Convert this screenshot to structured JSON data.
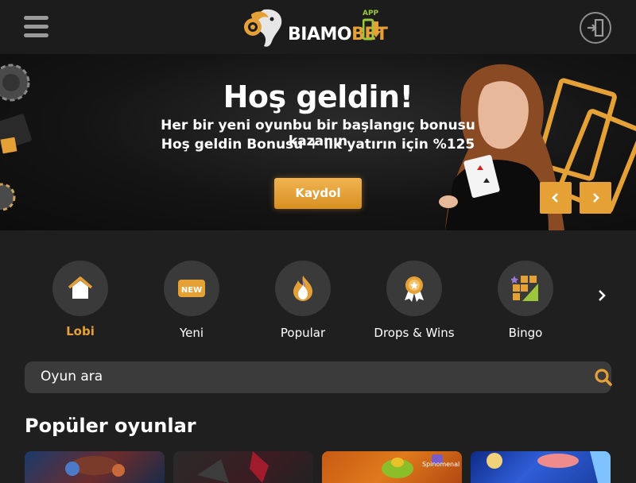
{
  "header": {
    "logo_text_a": "BIAMO",
    "logo_text_b": "BET",
    "app_badge": "APP",
    "menu_icon": "hamburger-menu-icon",
    "login_icon": "login-icon"
  },
  "hero": {
    "title": "Hoş geldin!",
    "line1": "Her bir yeni oyunbu bir başlangıç bonusu kazanın",
    "line2": "Hoş geldin Bonusu + ilk yatırın için %125",
    "register_label": "Kaydol",
    "prev_icon": "chevron-left-icon",
    "next_icon": "chevron-right-icon"
  },
  "categories": [
    {
      "label": "Lobi",
      "icon": "home-icon",
      "active": true
    },
    {
      "label": "Yeni",
      "icon": "new-badge-icon",
      "active": false
    },
    {
      "label": "Popular",
      "icon": "flame-icon",
      "active": false
    },
    {
      "label": "Drops & Wins",
      "icon": "award-ribbon-icon",
      "active": false
    },
    {
      "label": "Bingo",
      "icon": "bingo-grid-icon",
      "active": false
    }
  ],
  "search": {
    "placeholder": "Oyun ara",
    "icon": "search-icon"
  },
  "popular": {
    "title": "Popüler oyunlar",
    "game3_brand": "Spinomenal"
  },
  "colors": {
    "accent": "#e6a136",
    "background": "#1f1f1f",
    "header": "#1c1c1c",
    "circle": "#3a3a3a",
    "search": "#3b3b3b"
  }
}
